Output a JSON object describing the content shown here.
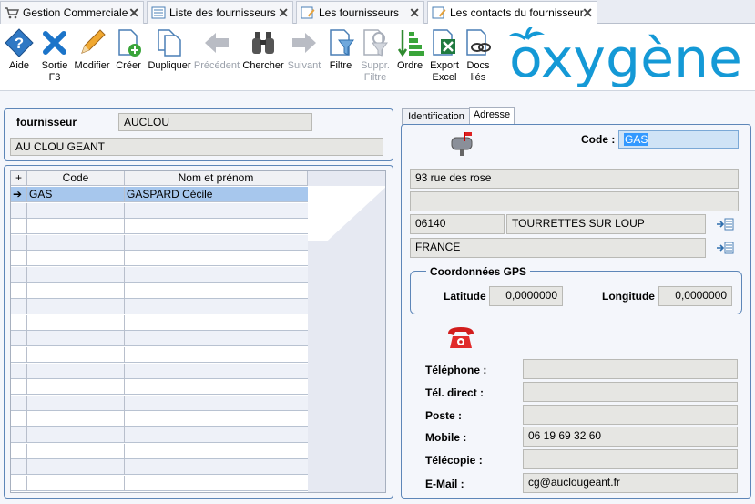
{
  "tabs": [
    {
      "label": "Gestion Commerciale",
      "active": false
    },
    {
      "label": "Liste des fournisseurs",
      "active": false
    },
    {
      "label": "Les fournisseurs",
      "active": false
    },
    {
      "label": "Les contacts du fournisseur",
      "active": true
    }
  ],
  "toolbar": {
    "aide": "Aide",
    "sortie": "Sortie",
    "sortie_key": "F3",
    "modifier": "Modifier",
    "creer": "Créer",
    "dupliquer": "Dupliquer",
    "precedent": "Précédent",
    "chercher": "Chercher",
    "suivant": "Suivant",
    "filtre": "Filtre",
    "suppr": "Suppr.",
    "suppr2": "Filtre",
    "ordre": "Ordre",
    "export": "Export",
    "export2": "Excel",
    "docs": "Docs",
    "docs2": "liés"
  },
  "logo_text": "oxygène",
  "fournisseur": {
    "label": "fournisseur",
    "code": "AUCLOU",
    "name": "AU CLOU GEANT"
  },
  "grid": {
    "headers": [
      "Code",
      "Nom et prénom"
    ],
    "rows": [
      {
        "code": "GAS",
        "name": "GASPARD Cécile"
      }
    ],
    "selected_marker": "➔"
  },
  "right_tabs": [
    "Identification",
    "Adresse"
  ],
  "address": {
    "code_label": "Code :",
    "code_value": "GAS",
    "line1": "93 rue des rose",
    "line2": "",
    "postal_code": "06140",
    "city": "TOURRETTES SUR LOUP",
    "country": "FRANCE"
  },
  "gps": {
    "title": "Coordonnées GPS",
    "latitude_label": "Latitude",
    "latitude": "0,0000000",
    "longitude_label": "Longitude",
    "longitude": "0,0000000"
  },
  "contact": {
    "telephone_label": "Téléphone :",
    "telephone": "",
    "tel_direct_label": "Tél. direct :",
    "tel_direct": "",
    "poste_label": "Poste :",
    "poste": "",
    "mobile_label": "Mobile :",
    "mobile": "06 19 69 32 60",
    "telecopie_label": "Télécopie :",
    "telecopie": "",
    "email_label": "E-Mail :",
    "email": "cg@auclougeant.fr"
  },
  "colors": {
    "accent": "#1499d6",
    "panel_border": "#5d86b8",
    "selection": "#a7c7ed"
  }
}
